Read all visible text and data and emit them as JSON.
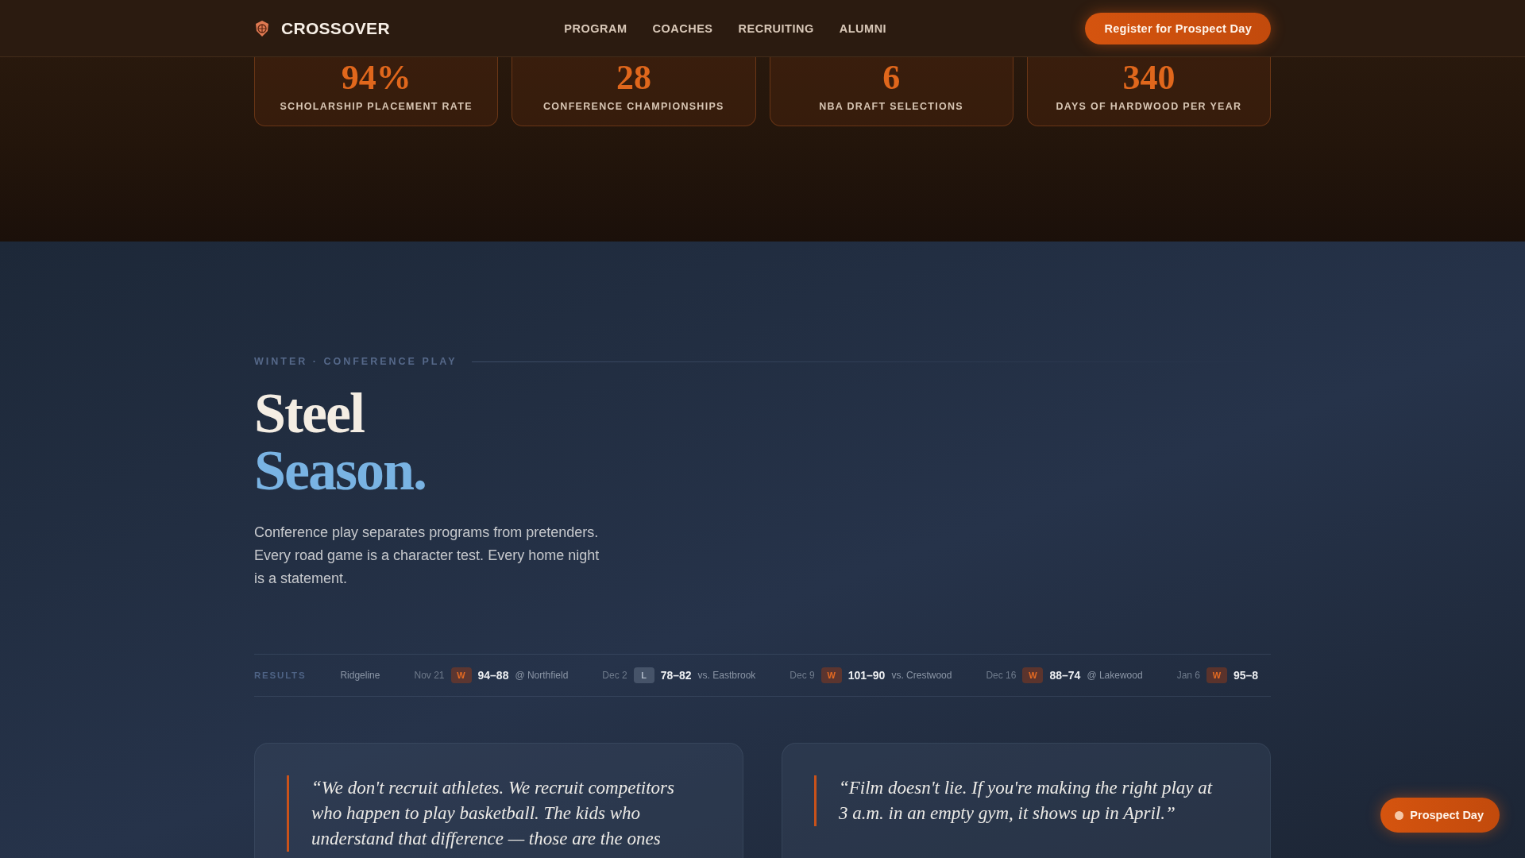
{
  "header": {
    "brand": "CROSSOVER",
    "nav": [
      "PROGRAM",
      "COACHES",
      "RECRUITING",
      "ALUMNI"
    ],
    "cta": "Register for Prospect Day"
  },
  "stats": [
    {
      "value": "94%",
      "label": "SCHOLARSHIP PLACEMENT RATE"
    },
    {
      "value": "28",
      "label": "CONFERENCE CHAMPIONSHIPS"
    },
    {
      "value": "6",
      "label": "NBA DRAFT SELECTIONS"
    },
    {
      "value": "340",
      "label": "DAYS OF HARDWOOD PER YEAR"
    }
  ],
  "season": {
    "eyebrow": "WINTER · CONFERENCE PLAY",
    "title_line_1": "Steel",
    "title_line_2": "Season.",
    "intro": "Conference play separates programs from pretenders. Every road game is a character test. Every home night is a statement."
  },
  "results": {
    "label": "RESULTS",
    "team": "Ridgeline",
    "games": [
      {
        "date": "Nov 21",
        "result": "W",
        "win": true,
        "score": "94–88",
        "opponent": "@ Northfield"
      },
      {
        "date": "Dec 2",
        "result": "L",
        "win": false,
        "score": "78–82",
        "opponent": "vs. Eastbrook"
      },
      {
        "date": "Dec 9",
        "result": "W",
        "win": true,
        "score": "101–90",
        "opponent": "vs. Crestwood"
      },
      {
        "date": "Dec 16",
        "result": "W",
        "win": true,
        "score": "88–74",
        "opponent": "@ Lakewood"
      },
      {
        "date": "Jan 6",
        "result": "W",
        "win": true,
        "score": "95–8"
      }
    ]
  },
  "quotes": [
    "“We don't recruit athletes. We recruit competitors who happen to play basketball. The kids who understand that difference — those are the ones",
    "“Film doesn't lie. If you're making the right play at 3 a.m. in an empty gym, it shows up in April.”"
  ],
  "floating_button": "Prospect Day"
}
